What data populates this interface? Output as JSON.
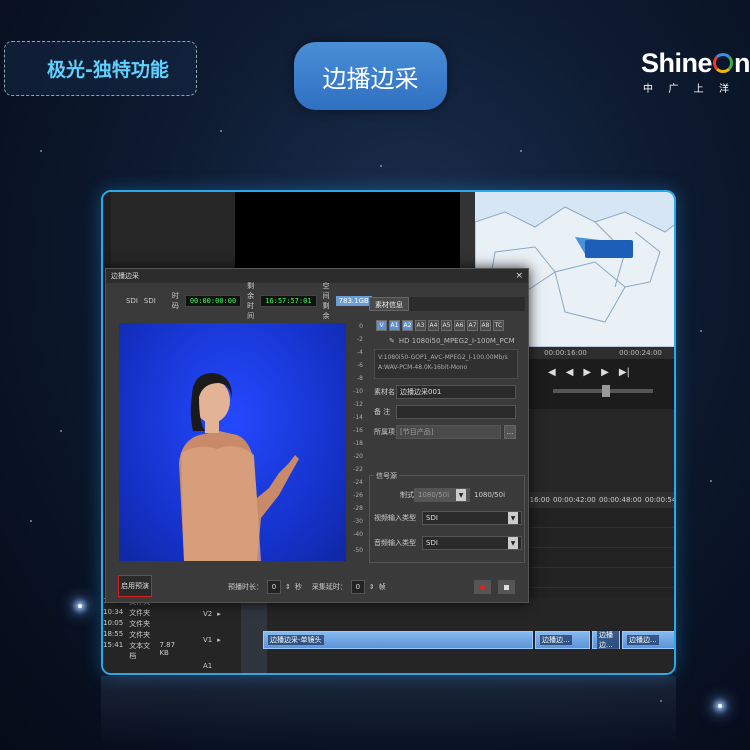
{
  "slide": {
    "feature_label": "极光-独特功能",
    "title": "边播边采",
    "logo": {
      "word_a": "Shine",
      "word_b": "n",
      "sub": [
        "中",
        "广",
        "上",
        "洋"
      ]
    }
  },
  "dialog": {
    "title": "边播边采",
    "close": "×",
    "sources": [
      "SDI",
      "SDI"
    ],
    "time_label": "时码",
    "timecode": "00:00:00:00",
    "remaining_time_label": "剩余时间",
    "remaining_time": "16:57:57:01",
    "remaining_space_label": "空间剩余",
    "remaining_space": "783.1GB",
    "vu_ticks": [
      "0",
      "-2",
      "-4",
      "-6",
      "-8",
      "-10",
      "-12",
      "-14",
      "-16",
      "-18",
      "-20",
      "-22",
      "-24",
      "-26",
      "-28",
      "-30",
      "-40",
      "-50"
    ],
    "enable_button": "启用预演",
    "preroll_label": "预播时长：",
    "preroll_value": "0",
    "seconds_unit": "秒",
    "capture_delay_label": "采集延时：",
    "capture_delay_value": "0",
    "frames_unit": "帧"
  },
  "asset_panel": {
    "tab": "素材信息",
    "channels": [
      "V",
      "A1",
      "A2",
      "A3",
      "A4",
      "A5",
      "A6",
      "A7",
      "A8",
      "TC"
    ],
    "format": "HD 1080i50_MPEG2_I-100M_PCM",
    "description": "V:1080i50-GOP1_AVC-MPEG2_I-100.00Mb/s A:WAV-PCM-48.0K-16bit-Mono",
    "name_label": "素材名",
    "name_value": "边播边采001",
    "note_label": "备 注",
    "note_value": "",
    "location_label": "所属项",
    "location_value": "[节目产品]",
    "ellipsis": "..."
  },
  "signal": {
    "title": "信号源",
    "format_label": "制式",
    "format_value": "1080/50i",
    "format_readout": "1080/50i",
    "video_input_label": "视频输入类型",
    "video_input_value": "SDI",
    "audio_input_label": "音频输入类型",
    "audio_input_value": "SDI"
  },
  "editor": {
    "map_tag": "",
    "monitor_ruler": [
      "00:00:16:00",
      "00:00:24:00"
    ],
    "timeline_ruler": [
      "16:00",
      "00:00:42:00",
      "00:00:48:00",
      "00:00:54"
    ],
    "files": [
      {
        "time": "13:30",
        "name": "文件夹",
        "size": ""
      },
      {
        "time": "10:34",
        "name": "文件夹",
        "size": ""
      },
      {
        "time": "10:05",
        "name": "文件夹",
        "size": ""
      },
      {
        "time": "18:55",
        "name": "文件夹",
        "size": ""
      },
      {
        "time": "15:41",
        "name": "文本文档",
        "size": "7.87 KB"
      }
    ],
    "tracks": [
      "V2",
      "V1",
      "A1"
    ],
    "clip_main": "边播边采-单镜头",
    "clip_short": "边播边...",
    "clip_short_count": 3
  },
  "colors": {
    "accent": "#2aa8e8",
    "title_bg": "#3b7fcc",
    "feature_text": "#5fd0ff",
    "green_screen_blue": "#1c3ce0"
  }
}
